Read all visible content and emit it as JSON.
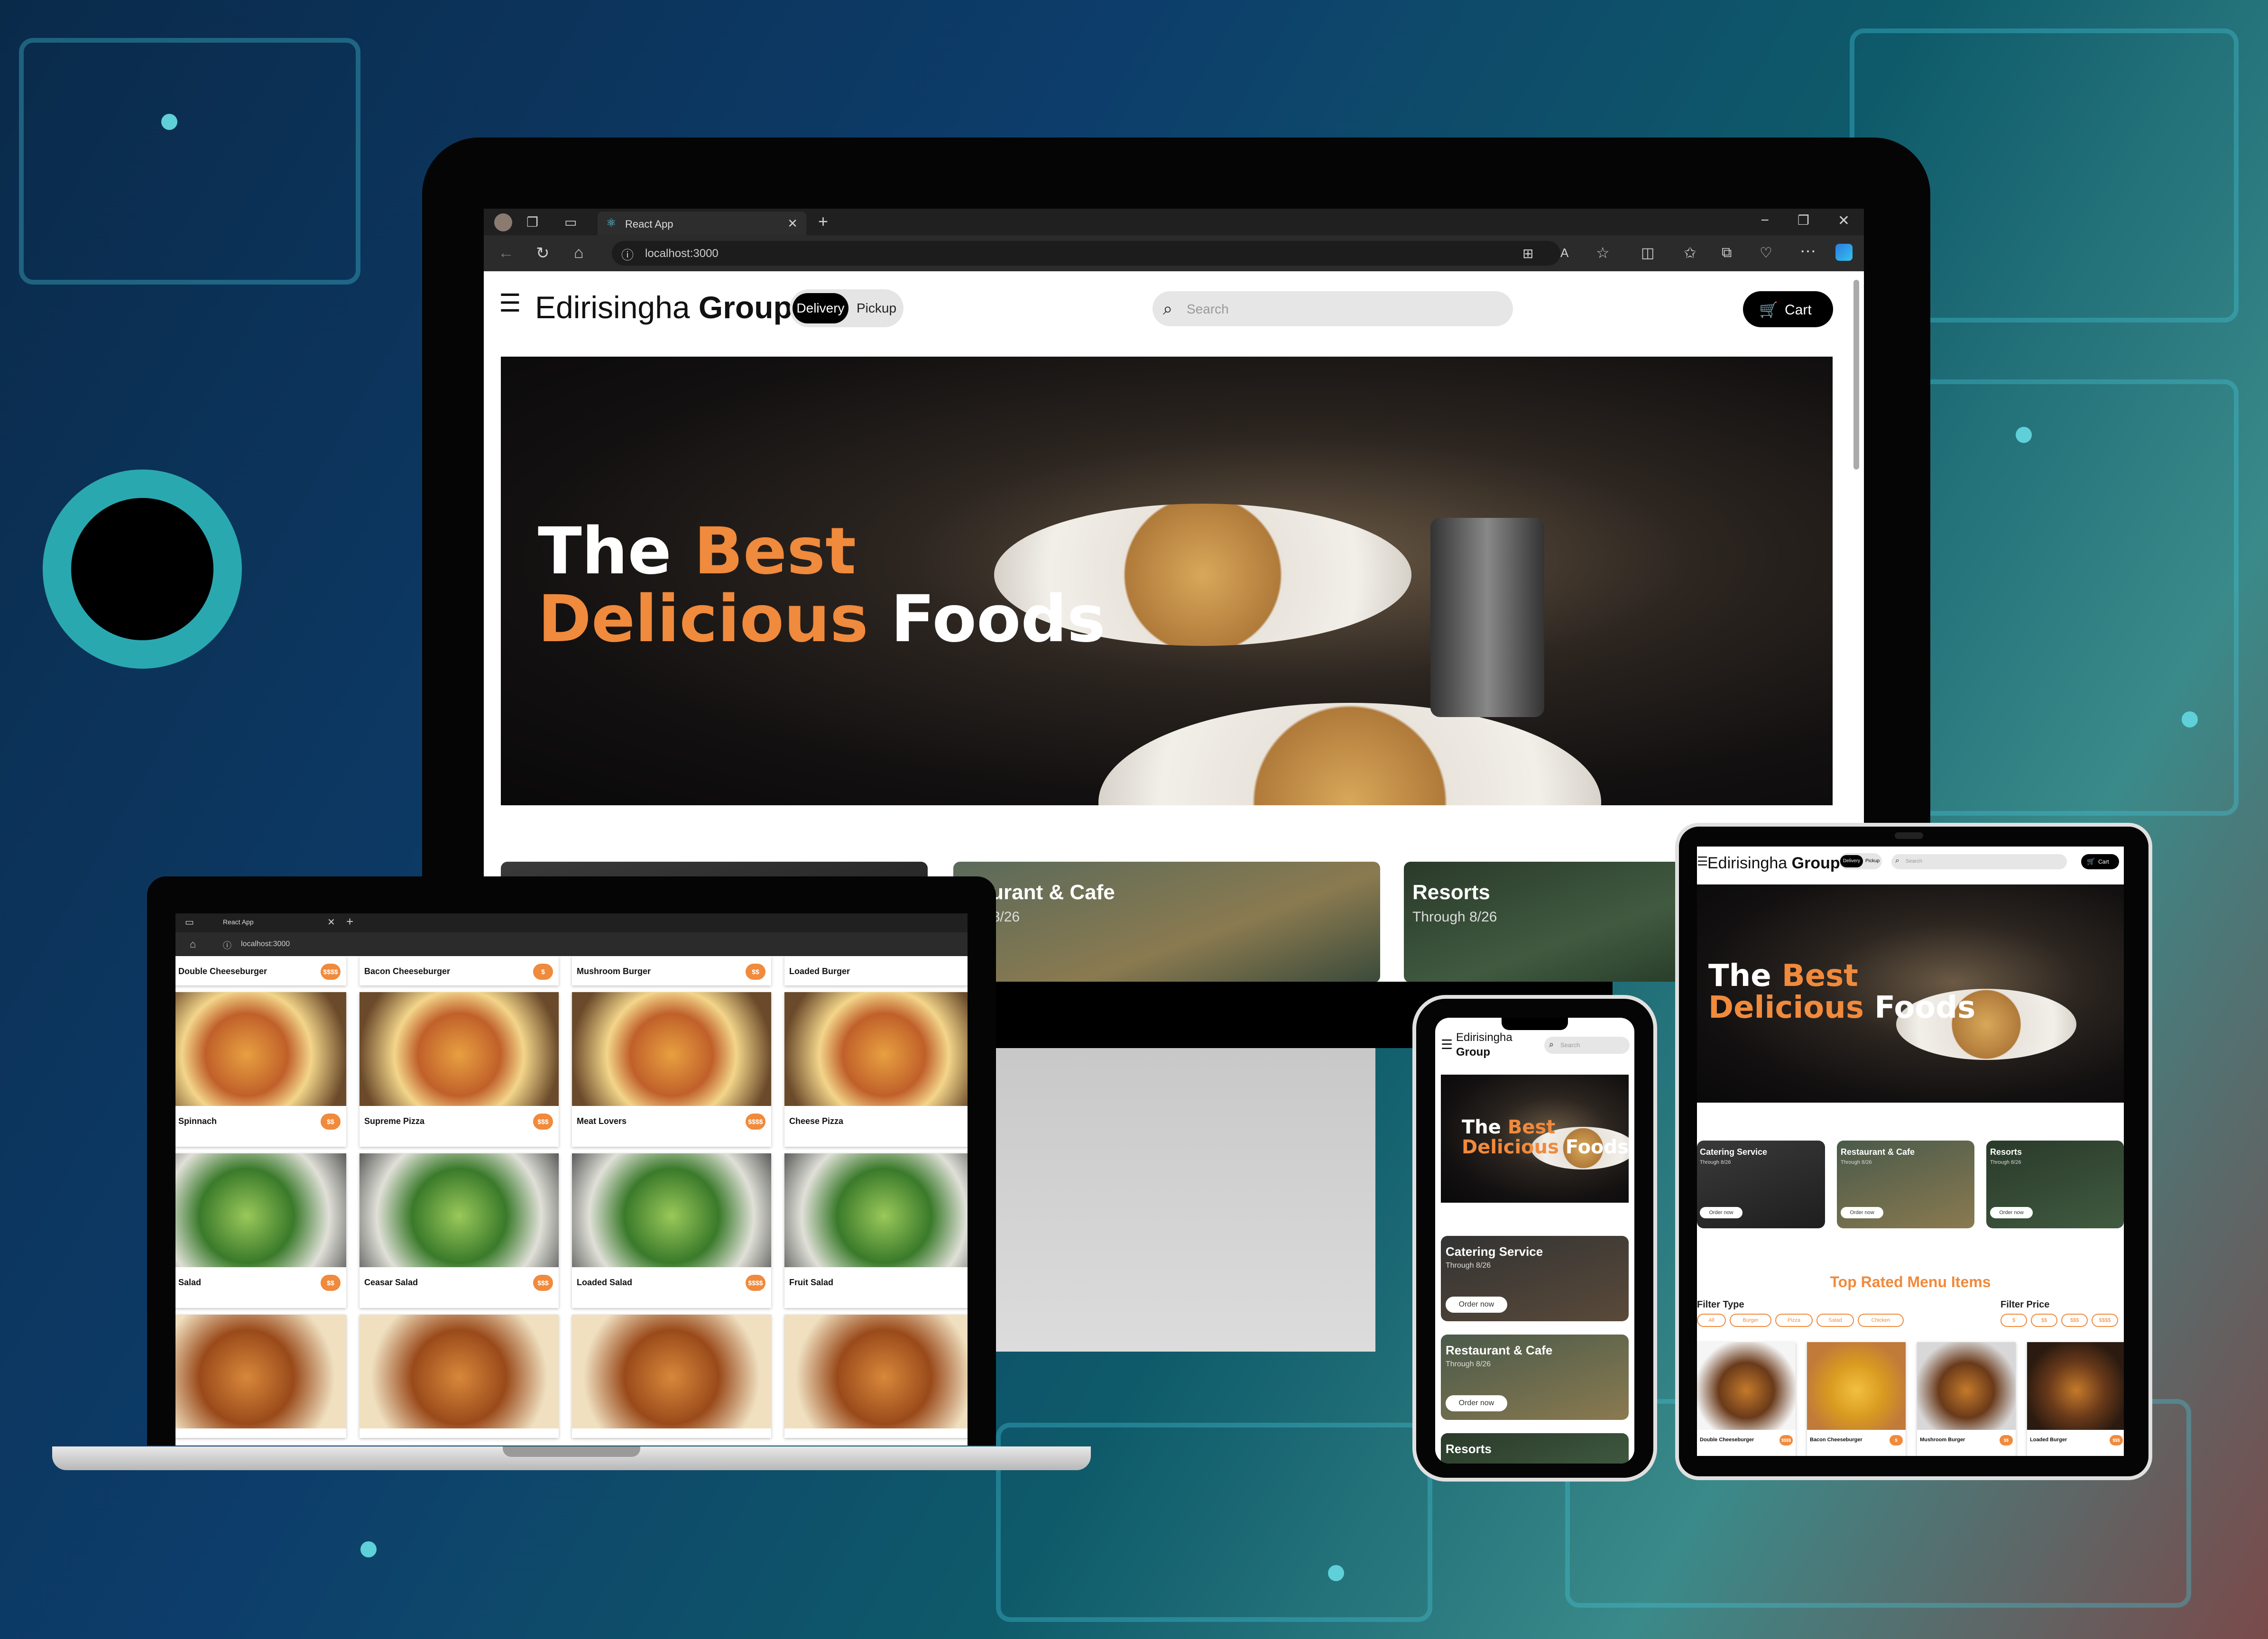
{
  "brand": {
    "first": "Edirisingha",
    "second": "Group"
  },
  "mobile_brand": {
    "first": "Edirisingha",
    "second": "Group"
  },
  "toggle": {
    "delivery": "Delivery",
    "pickup": "Pickup"
  },
  "search": {
    "placeholder": "Search"
  },
  "cart": {
    "label": "Cart"
  },
  "browser": {
    "tab_title": "React App",
    "url": "localhost:3000"
  },
  "hero": {
    "line1_white": "The ",
    "line1_orange": "Best",
    "line2_orange": "Delicious ",
    "line2_white": "Foods"
  },
  "featured": [
    {
      "title": "Catering Service",
      "sub": "Through 8/26",
      "button": "Order now"
    },
    {
      "title": "Restaurant & Cafe",
      "sub": "Through 8/26",
      "button": "Order now"
    },
    {
      "title": "Resorts",
      "sub": "Through 8/26",
      "button": "Order now"
    }
  ],
  "desktop_visible_cards": {
    "partial": "taurant & Cafe",
    "partial_sub": "gh 8/26"
  },
  "menu": {
    "title": "Top Rated Menu Items",
    "filter_type_label": "Filter Type",
    "filter_type_options": [
      "All",
      "Burger",
      "Pizza",
      "Salad",
      "Chicken"
    ],
    "filter_price_label": "Filter Price",
    "filter_price_options": [
      "$",
      "$$",
      "$$$",
      "$$$$"
    ]
  },
  "laptop_items": [
    {
      "name": "Double Cheeseburger",
      "price": "$$$$",
      "img": "burger"
    },
    {
      "name": "Bacon Cheeseburger",
      "price": "$",
      "img": "burger"
    },
    {
      "name": "Mushroom Burger",
      "price": "$$",
      "img": "burger"
    },
    {
      "name": "Loaded Burger",
      "price": "",
      "img": "burger"
    },
    {
      "name": "Spinnach",
      "price": "$$",
      "img": "pizza"
    },
    {
      "name": "Supreme Pizza",
      "price": "$$$",
      "img": "pizza"
    },
    {
      "name": "Meat Lovers",
      "price": "$$$$",
      "img": "pizza"
    },
    {
      "name": "Cheese Pizza",
      "price": "",
      "img": "pizza"
    },
    {
      "name": "Salad",
      "price": "$$",
      "img": "salad"
    },
    {
      "name": "Ceasar Salad",
      "price": "$$$",
      "img": "salad"
    },
    {
      "name": "Loaded Salad",
      "price": "$$$$",
      "img": "salad"
    },
    {
      "name": "Fruit Salad",
      "price": "",
      "img": "salad"
    },
    {
      "name": "",
      "price": "",
      "img": "chicken"
    },
    {
      "name": "",
      "price": "",
      "img": "chicken"
    },
    {
      "name": "",
      "price": "",
      "img": "chicken"
    },
    {
      "name": "",
      "price": "",
      "img": "chicken"
    }
  ],
  "tablet_items": [
    {
      "name": "Double Cheeseburger",
      "price": "$$$$"
    },
    {
      "name": "Bacon Cheeseburger",
      "price": "$"
    },
    {
      "name": "Mushroom Burger",
      "price": "$$"
    },
    {
      "name": "Loaded Burger",
      "price": "$$$"
    }
  ]
}
